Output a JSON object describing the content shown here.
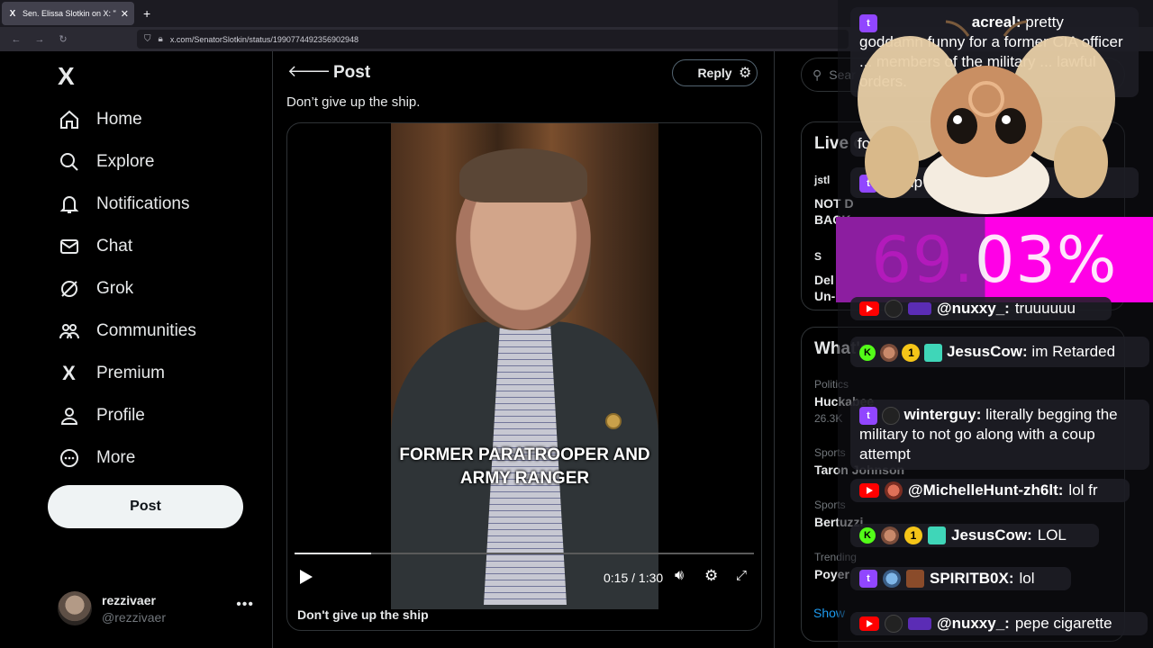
{
  "browser": {
    "tab_title": "Sen. Elissa Slotkin on X: \"We wa",
    "tab_icon": "X",
    "url": "x.com/SenatorSlotkin/status/1990774492356902948"
  },
  "nav": {
    "logo": "X",
    "items": [
      {
        "label": "Home",
        "icon": "home-icon"
      },
      {
        "label": "Explore",
        "icon": "search-icon"
      },
      {
        "label": "Notifications",
        "icon": "bell-icon"
      },
      {
        "label": "Chat",
        "icon": "mail-icon"
      },
      {
        "label": "Grok",
        "icon": "grok-icon"
      },
      {
        "label": "Communities",
        "icon": "people-icon"
      },
      {
        "label": "Premium",
        "icon": "x-icon"
      },
      {
        "label": "Profile",
        "icon": "person-icon"
      },
      {
        "label": "More",
        "icon": "more-circle-icon"
      }
    ],
    "post_label": "Post"
  },
  "account": {
    "name": "rezzivaer",
    "handle": "@rezzivaer"
  },
  "post": {
    "header_title": "Post",
    "reply_label": "Reply",
    "text": "Don’t give up the ship.",
    "video_caption_overlay": "FORMER PARATROOPER AND ARMY RANGER",
    "time": "0:15 / 1:30",
    "progress_fraction": 0.167,
    "video_title": "Don't give up the ship"
  },
  "right": {
    "search_placeholder": "Sear",
    "live_title": "Live o",
    "live_rows": [
      {
        "user": "jstl",
        "line1": "NOT D",
        "line2": "BACK"
      },
      {
        "user": "S",
        "line1": "Del",
        "line2": "Un-"
      }
    ],
    "whats_title": "What's",
    "trends": [
      {
        "cat": "Politics",
        "name": "Huckabee",
        "sub": "26.3K"
      },
      {
        "cat": "Sports",
        "name": "Taron Johnson",
        "sub": ""
      },
      {
        "cat": "Sports",
        "name": "Bertuzzi",
        "sub": ""
      },
      {
        "cat": "Trending",
        "name": "Poyer",
        "sub": ""
      }
    ],
    "show_more": "Show"
  },
  "overlay": {
    "percent_dim": "69.",
    "percent_bright": "03%",
    "chat": [
      {
        "user": "acreal:",
        "text": "pretty goddamn funny for a former CIA officer ... members of the military ... lawful orders."
      },
      {
        "user": "",
        "text": "for"
      },
      {
        "user": "",
        "text": "womp womp"
      },
      {
        "user": "@nuxxy_:",
        "text": "truuuuuu"
      },
      {
        "user": "JesusCow:",
        "text": "im Retarded"
      },
      {
        "user": "winterguy:",
        "text": "literally begging the military to not go along with a coup attempt"
      },
      {
        "user": "@MichelleHunt-zh6lt:",
        "text": "lol fr"
      },
      {
        "user": "JesusCow:",
        "text": "LOL"
      },
      {
        "user": "SPIRITB0X:",
        "text": "lol"
      },
      {
        "user": "@nuxxy_:",
        "text": "pepe cigarette"
      }
    ],
    "badge_one": "1",
    "colors": {
      "twitch": "#9146ff",
      "youtube": "#ff0000",
      "kick": "#53fc18",
      "percent_left": "#8c1ea0",
      "percent_right": "#ff00e6"
    }
  }
}
